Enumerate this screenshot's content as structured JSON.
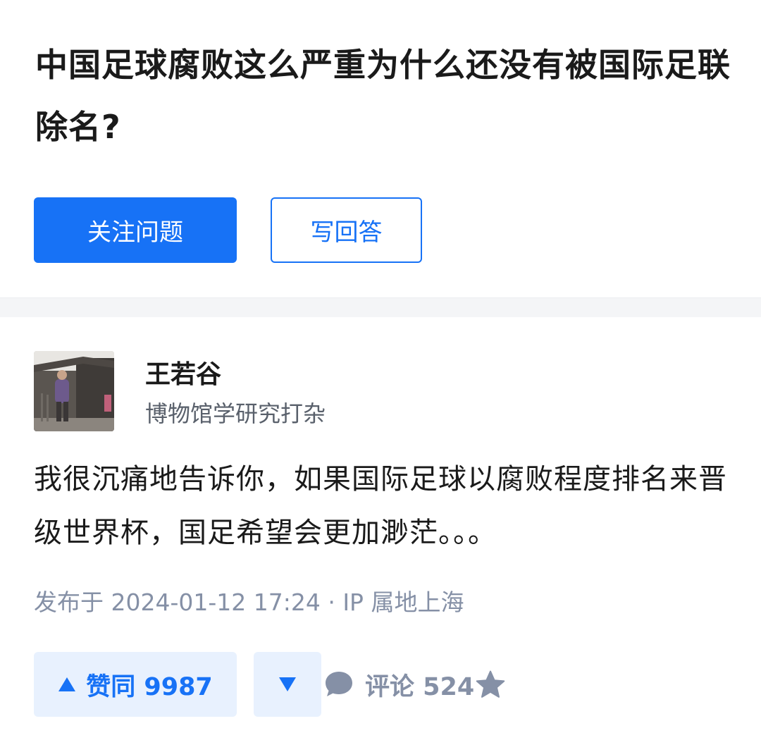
{
  "question": {
    "title": "中国足球腐败这么严重为什么还没有被国际足联除名?",
    "follow_label": "关注问题",
    "write_answer_label": "写回答"
  },
  "answer": {
    "author": {
      "name": "王若谷",
      "bio": "博物馆学研究打杂"
    },
    "content": "我很沉痛地告诉你，如果国际足球以腐败程度排名来晋级世界杯，国足希望会更加渺茫。。。",
    "meta": "发布于 2024-01-12 17:24 · IP 属地上海",
    "actions": {
      "upvote_label": "赞同 9987",
      "comment_label": "评论 524"
    }
  },
  "icons": {
    "upvote": "triangle-up-icon",
    "downvote": "triangle-down-icon",
    "comment": "comment-bubble-icon",
    "favorite": "star-icon"
  },
  "colors": {
    "brand_blue": "#1772f6",
    "vote_bg": "#e8f1fe",
    "meta_gray": "#8590a6",
    "title_text": "#1a1a1a"
  }
}
